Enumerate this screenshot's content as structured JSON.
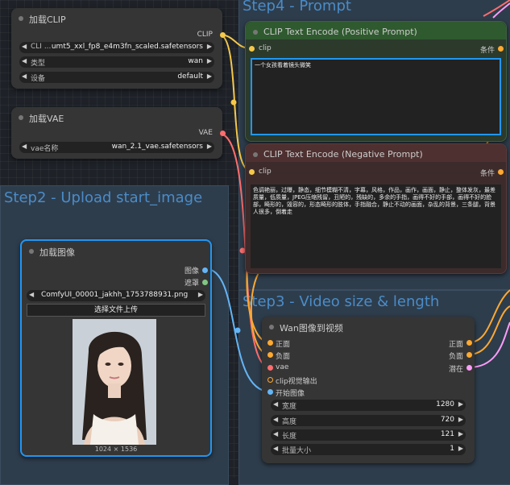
{
  "groups": {
    "step4": "Step4 - Prompt",
    "step2": "Step2 - Upload start_image",
    "step3": "Step3 - Video size & length"
  },
  "load_clip": {
    "title": "加载CLIP",
    "output": "CLIP",
    "widgets": [
      {
        "label": "CLI ...",
        "value": "umt5_xxl_fp8_e4m3fn_scaled.safetensors"
      },
      {
        "label": "类型",
        "value": "wan"
      },
      {
        "label": "设备",
        "value": "default"
      }
    ]
  },
  "load_vae": {
    "title": "加载VAE",
    "output": "VAE",
    "widget": {
      "label": "vae名称",
      "value": "wan_2.1_vae.safetensors"
    }
  },
  "pos_prompt": {
    "title": "CLIP Text Encode (Positive Prompt)",
    "input": "clip",
    "output": "条件",
    "text": "一个女孩看着镜头微笑"
  },
  "neg_prompt": {
    "title": "CLIP Text Encode (Negative Prompt)",
    "input": "clip",
    "output": "条件",
    "text": "色调艳丽，过曝，静态，细节模糊不清，字幕，风格，作品，画作，画面，静止，整体发灰，最差质量，低质量，JPEG压缩残留，丑陋的，残缺的，多余的手指，画得不好的手部，画得不好的脸部，畸形的，毁容的，形态畸形的肢体，手指融合，静止不动的画面，杂乱的背景，三条腿，背景人很多，倒着走"
  },
  "load_image": {
    "title": "加载图像",
    "outputs": [
      "图像",
      "遮罩"
    ],
    "file": "ComfyUI_00001_jakhh_1753788931.png",
    "upload_label": "选择文件上传",
    "dims": "1024 × 1536"
  },
  "wan_node": {
    "title": "Wan图像到视频",
    "inputs": [
      "正面",
      "负面",
      "vae",
      "clip视觉输出",
      "开始图像"
    ],
    "outputs": [
      "正面",
      "负面",
      "潜在"
    ],
    "widgets": [
      {
        "label": "宽度",
        "value": "1280"
      },
      {
        "label": "高度",
        "value": "720"
      },
      {
        "label": "长度",
        "value": "121"
      },
      {
        "label": "批量大小",
        "value": "1"
      }
    ]
  },
  "colors": {
    "clip": "#f5c84a",
    "vae": "#ff6e6e",
    "conditioning": "#ffa931",
    "image": "#64b5f6",
    "mask": "#81c784",
    "latent": "#ff9cf9",
    "selected": "#2196f3"
  }
}
